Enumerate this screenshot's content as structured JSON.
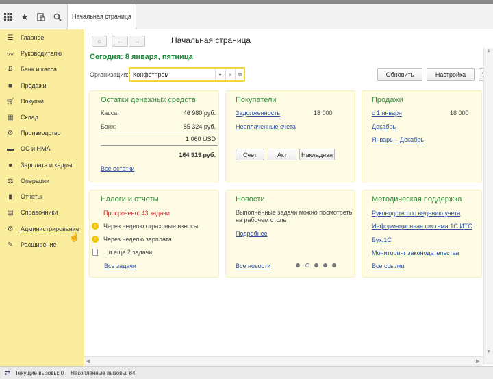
{
  "topbar": {
    "icons": [
      "apps-grid-icon",
      "star-icon",
      "history-icon",
      "search-icon"
    ],
    "tab_label": "Начальная страница"
  },
  "sidebar": {
    "items": [
      {
        "label": "Главное",
        "icon": "list-icon"
      },
      {
        "label": "Руководителю",
        "icon": "trend-icon"
      },
      {
        "label": "Банк и касса",
        "icon": "ruble-icon"
      },
      {
        "label": "Продажи",
        "icon": "bag-icon"
      },
      {
        "label": "Покупки",
        "icon": "cart-icon"
      },
      {
        "label": "Склад",
        "icon": "warehouse-icon"
      },
      {
        "label": "Производство",
        "icon": "factory-icon"
      },
      {
        "label": "ОС и НМА",
        "icon": "truck-icon"
      },
      {
        "label": "Зарплата и кадры",
        "icon": "person-icon"
      },
      {
        "label": "Операции",
        "icon": "scales-icon"
      },
      {
        "label": "Отчеты",
        "icon": "chart-icon"
      },
      {
        "label": "Справочники",
        "icon": "book-icon"
      },
      {
        "label": "Администрирование",
        "icon": "gear-icon"
      },
      {
        "label": "Расширение",
        "icon": "wrench-icon"
      }
    ]
  },
  "header": {
    "title": "Начальная страница",
    "today": "Сегодня: 8 января, пятница",
    "org_label": "Организация:",
    "org_value": "Конфетпром",
    "refresh_button": "Обновить",
    "settings_button": "Настройка",
    "help_button": "?"
  },
  "cash": {
    "title": "Остатки денежных средств",
    "kassa_label": "Касса:",
    "kassa_value": "46 980 руб.",
    "bank_label": "Банк:",
    "bank_value": "85 324 руб.",
    "usd_value": "1 060 USD",
    "total_value": "164 919 руб.",
    "all_link": "Все остатки"
  },
  "buyers": {
    "title": "Покупатели",
    "debt_link": "Задолженность",
    "debt_value": "18 000",
    "unpaid_link": "Неоплаченные счета",
    "btn_invoice": "Счет",
    "btn_act": "Акт",
    "btn_waybill": "Накладная"
  },
  "sales": {
    "title": "Продажи",
    "since_link": "с 1 января",
    "since_value": "18 000",
    "dec_link": "Декабрь",
    "range_link": "Январь – Декабрь"
  },
  "taxes": {
    "title": "Налоги и отчеты",
    "overdue": "Просрочено: 43 задачи",
    "task1": "Через неделю страховые взносы",
    "task2": "Через неделю зарплата",
    "task3": "...и еще 2 задачи",
    "all_link": "Все задачи"
  },
  "news": {
    "title": "Новости",
    "text_line1": "Выполненные задачи можно посмотреть",
    "text_line2": "на рабочем столе",
    "more_link": "Подробнее",
    "all_link": "Все новости",
    "dots_total": 5,
    "dots_active_index": 0
  },
  "support": {
    "title": "Методическая поддержка",
    "link1": "Руководство по ведению учета",
    "link2": "Информационная система 1С:ИТС",
    "link3": "Бух.1С",
    "link4": "Мониторинг законодательства",
    "all_link": "Все ссылки"
  },
  "statusbar": {
    "current_calls": "Текущие вызовы: 0",
    "accumulated_calls": "Накопленные вызовы: 84"
  }
}
